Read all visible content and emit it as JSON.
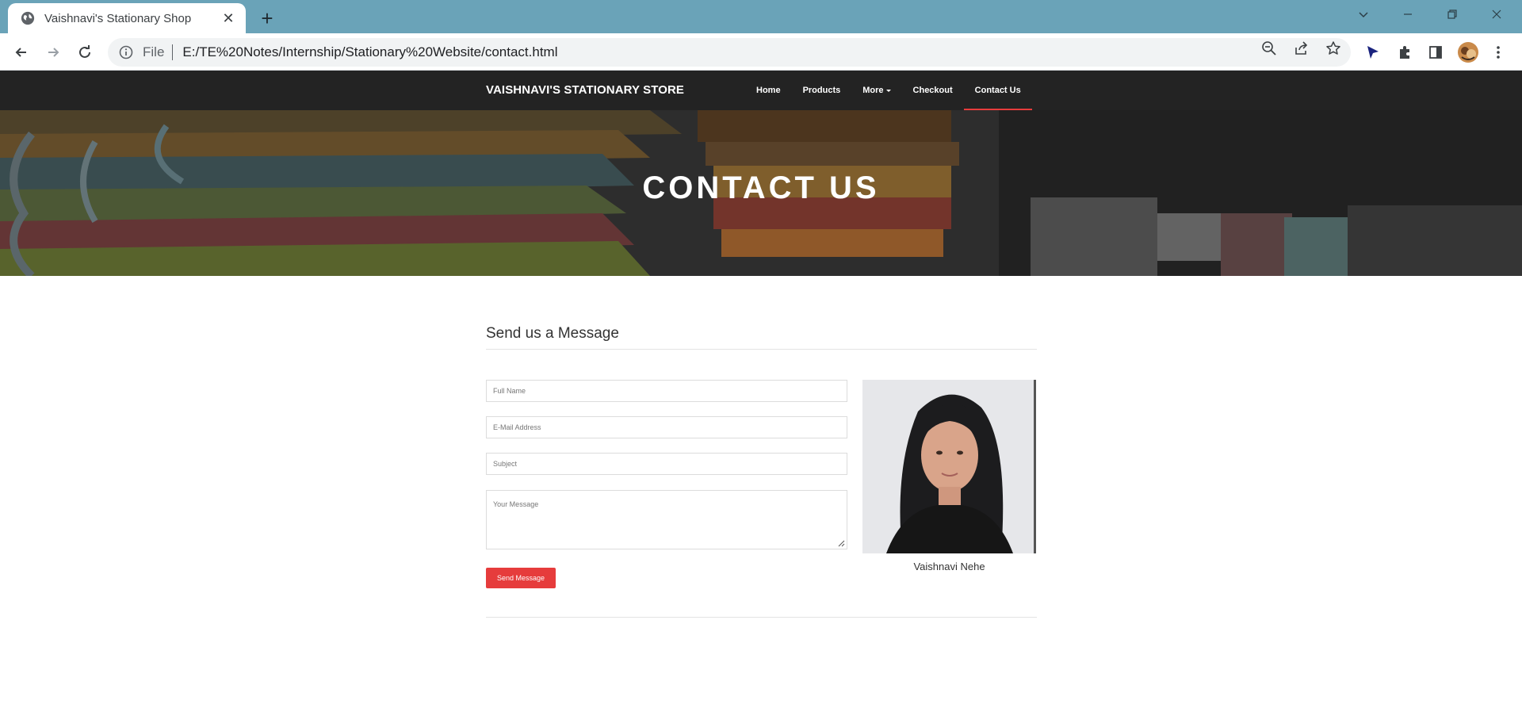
{
  "browser": {
    "tab_title": "Vaishnavi's Stationary Shop",
    "new_tab_label": "+",
    "omnibox_scheme": "File",
    "url": "E:/TE%20Notes/Internship/Stationary%20Website/contact.html"
  },
  "site": {
    "brand": "VAISHNAVI'S STATIONARY STORE",
    "nav": [
      {
        "label": "Home",
        "active": false
      },
      {
        "label": "Products",
        "active": false
      },
      {
        "label": "More",
        "active": false,
        "dropdown": true
      },
      {
        "label": "Checkout",
        "active": false
      },
      {
        "label": "Contact Us",
        "active": true
      }
    ],
    "accent_color": "#e63c3c",
    "nav_background": "#232323"
  },
  "hero": {
    "title": "CONTACT US"
  },
  "contact": {
    "section_title": "Send us a Message",
    "fields": {
      "name_placeholder": "Full Name",
      "email_placeholder": "E-Mail Address",
      "subject_placeholder": "Subject",
      "message_placeholder": "Your Message"
    },
    "submit_label": "Send Message",
    "person_name": "Vaishnavi Nehe"
  }
}
